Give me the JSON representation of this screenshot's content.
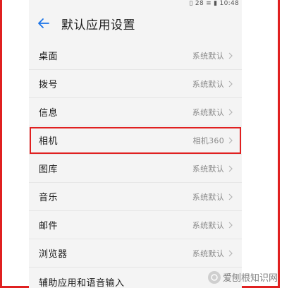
{
  "status_bar": {
    "text": "▯ 28 ≡ ▮ 10:48"
  },
  "header": {
    "title": "默认应用设置"
  },
  "rows": [
    {
      "label": "桌面",
      "value": "系统默认"
    },
    {
      "label": "拨号",
      "value": "系统默认"
    },
    {
      "label": "信息",
      "value": "系统默认"
    },
    {
      "label": "相机",
      "value": "相机360"
    },
    {
      "label": "图库",
      "value": "系统默认"
    },
    {
      "label": "音乐",
      "value": "系统默认"
    },
    {
      "label": "邮件",
      "value": "系统默认"
    },
    {
      "label": "浏览器",
      "value": "系统默认"
    },
    {
      "label": "辅助应用和语音输入",
      "value": ""
    }
  ],
  "watermark": {
    "text": "爱刨根知识网"
  },
  "colors": {
    "accent": "#1a73e8",
    "highlight": "#e02020"
  }
}
